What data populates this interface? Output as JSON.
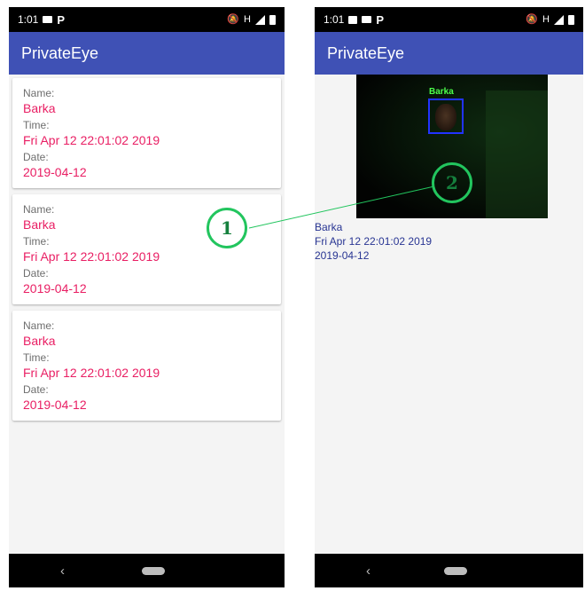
{
  "left_screen": {
    "status": {
      "time": "1:01"
    },
    "app_title": "PrivateEye",
    "cards": [
      {
        "name_label": "Name:",
        "name": "Barka",
        "time_label": "Time:",
        "time": "Fri Apr 12 22:01:02 2019",
        "date_label": "Date:",
        "date": "2019-04-12"
      },
      {
        "name_label": "Name:",
        "name": "Barka",
        "time_label": "Time:",
        "time": "Fri Apr 12 22:01:02 2019",
        "date_label": "Date:",
        "date": "2019-04-12"
      },
      {
        "name_label": "Name:",
        "name": "Barka",
        "time_label": "Time:",
        "time": "Fri Apr 12 22:01:02 2019",
        "date_label": "Date:",
        "date": "2019-04-12"
      }
    ],
    "nav": {
      "back_glyph": "‹"
    }
  },
  "right_screen": {
    "status": {
      "time": "1:01"
    },
    "app_title": "PrivateEye",
    "photo": {
      "face_label": "Barka"
    },
    "detail": {
      "name": "Barka",
      "time": "Fri Apr 12 22:01:02 2019",
      "date": "2019-04-12"
    },
    "nav": {
      "back_glyph": "‹"
    }
  },
  "annotations": {
    "callout_1": "1",
    "callout_2": "2"
  },
  "colors": {
    "app_bar": "#3f51b5",
    "value_text": "#e91e63",
    "detail_text": "#283593",
    "callout": "#22c55e",
    "face_box": "#2233ff"
  }
}
